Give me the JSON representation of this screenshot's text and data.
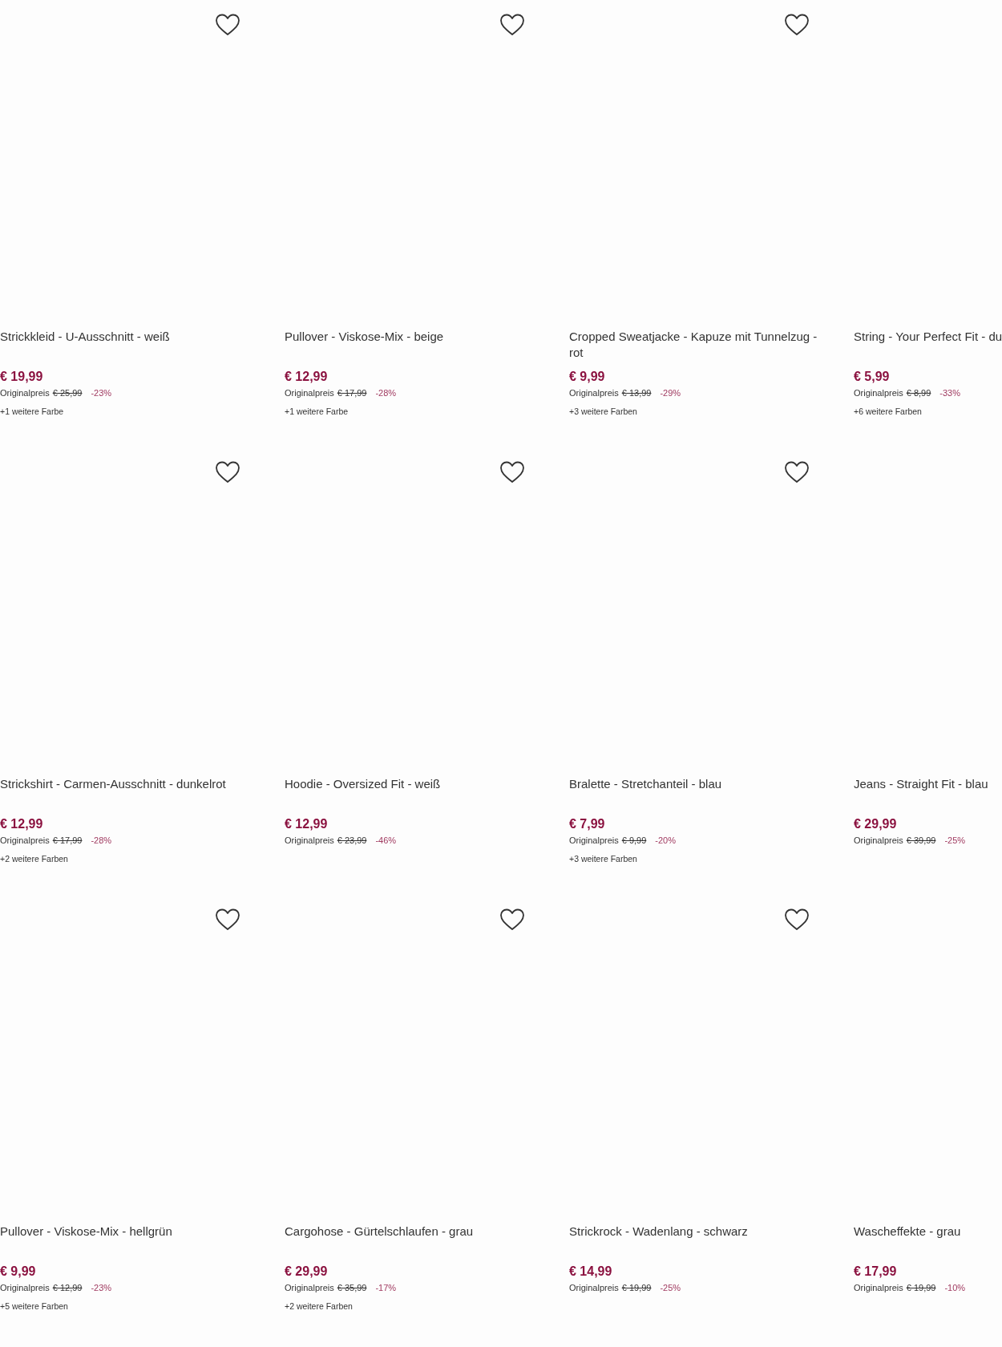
{
  "products": [
    {
      "name": "Strickkleid - U-Ausschnitt - weiß",
      "price": "€ 19,99",
      "original_label": "Originalpreis",
      "original_price": "€ 25,99",
      "discount": "-23%",
      "more_colors": "+1 weitere Farbe",
      "favorite": false
    },
    {
      "name": "Pullover - Viskose-Mix - beige",
      "price": "€ 12,99",
      "original_label": "Originalpreis",
      "original_price": "€ 17,99",
      "discount": "-28%",
      "more_colors": "+1 weitere Farbe",
      "favorite": false
    },
    {
      "name": "Cropped Sweatjacke - Kapuze mit Tunnelzug - rot",
      "price": "€ 9,99",
      "original_label": "Originalpreis",
      "original_price": "€ 13,99",
      "discount": "-29%",
      "more_colors": "+3 weitere Farben",
      "favorite": false
    },
    {
      "name": "String - Your Perfect Fit - du",
      "price": "€ 5,99",
      "original_label": "Originalpreis",
      "original_price": "€ 8,99",
      "discount": "-33%",
      "more_colors": "+6 weitere Farben"
    },
    {
      "name": "Strickshirt - Carmen-Ausschnitt - dunkelrot",
      "price": "€ 12,99",
      "original_label": "Originalpreis",
      "original_price": "€ 17,99",
      "discount": "-28%",
      "more_colors": "+2 weitere Farben",
      "favorite": false
    },
    {
      "name": "Hoodie - Oversized Fit - weiß",
      "price": "€ 12,99",
      "original_label": "Originalpreis",
      "original_price": "€ 23,99",
      "discount": "-46%",
      "favorite": false
    },
    {
      "name": "Bralette - Stretchanteil - blau",
      "price": "€ 7,99",
      "original_label": "Originalpreis",
      "original_price": "€ 9,99",
      "discount": "-20%",
      "more_colors": "+3 weitere Farben",
      "favorite": false
    },
    {
      "name": "Jeans - Straight Fit - blau",
      "price": "€ 29,99",
      "original_label": "Originalpreis",
      "original_price": "€ 39,99",
      "discount": "-25%"
    },
    {
      "name": "Pullover - Viskose-Mix - hellgrün",
      "price": "€ 9,99",
      "original_label": "Originalpreis",
      "original_price": "€ 12,99",
      "discount": "-23%",
      "more_colors": "+5 weitere Farben",
      "favorite": false
    },
    {
      "name": "Cargohose - Gürtelschlaufen - grau",
      "price": "€ 29,99",
      "original_label": "Originalpreis",
      "original_price": "€ 35,99",
      "discount": "-17%",
      "more_colors": "+2 weitere Farben",
      "favorite": false
    },
    {
      "name": "Strickrock - Wadenlang - schwarz",
      "price": "€ 14,99",
      "original_label": "Originalpreis",
      "original_price": "€ 19,99",
      "discount": "-25%",
      "favorite": false
    },
    {
      "name": "Wascheffekte - grau",
      "price": "€ 17,99",
      "original_label": "Originalpreis",
      "original_price": "€ 19,99",
      "discount": "-10%"
    }
  ]
}
